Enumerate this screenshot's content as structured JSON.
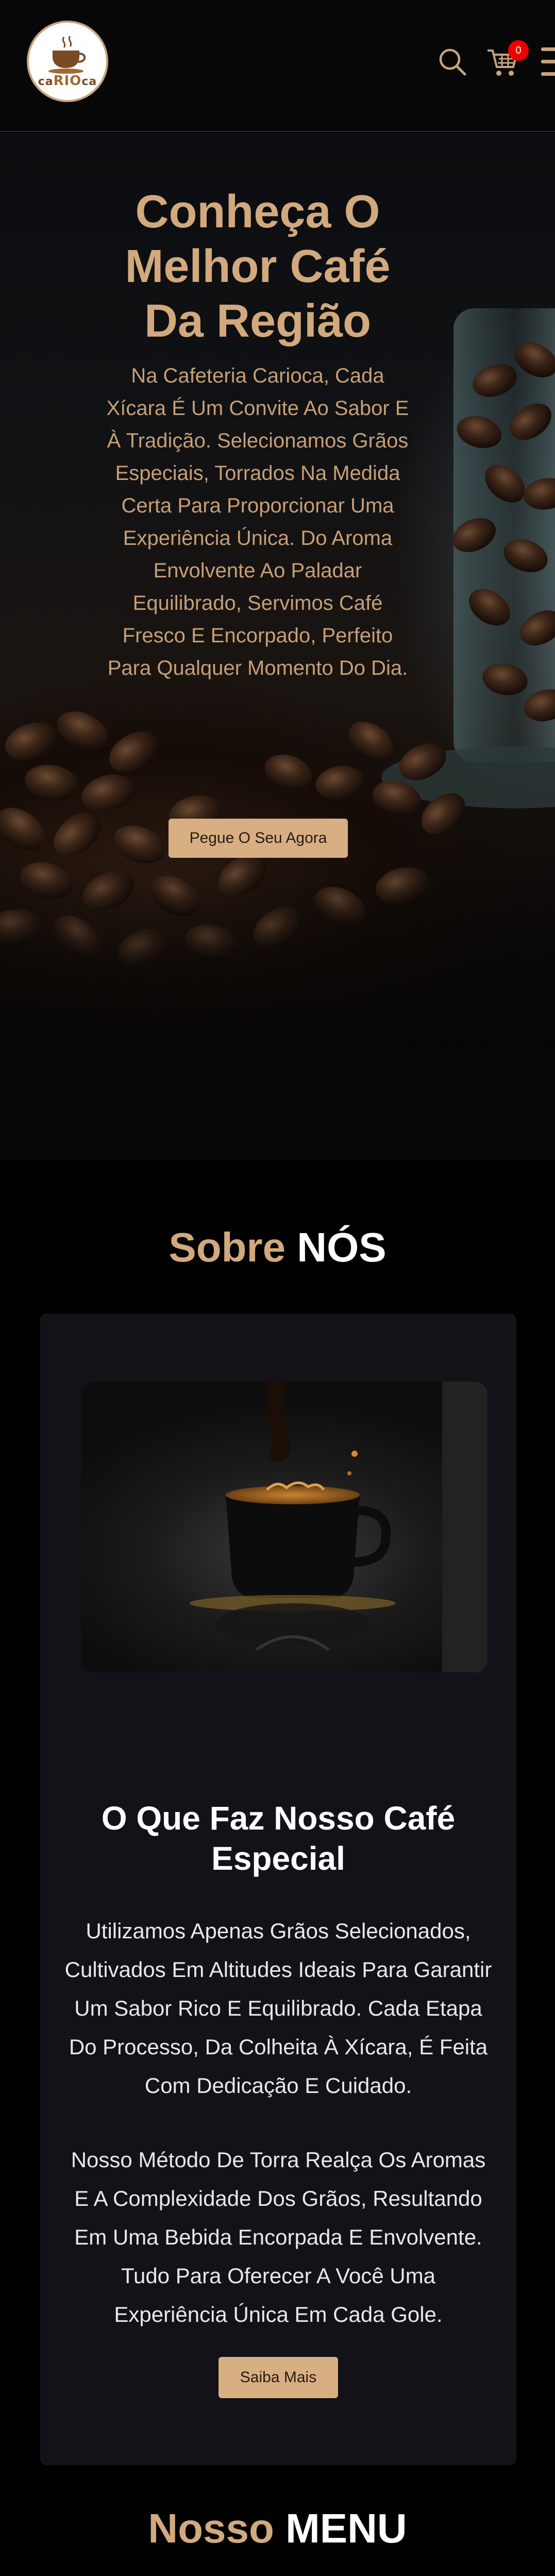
{
  "header": {
    "logo_text_pre": "ca",
    "logo_text_rio": "RIO",
    "logo_text_post": "ca",
    "cart_count": "0",
    "icons": [
      "search-icon",
      "cart-icon",
      "hamburger-menu-icon"
    ],
    "accent_color": "#c8a47e",
    "badge_color": "#e00000"
  },
  "hero": {
    "title": "Conheça O Melhor Café Da Região",
    "text": "Na Cafeteria Carioca, Cada Xícara É Um Convite Ao Sabor E À Tradição. Selecionamos Grãos Especiais, Torrados Na Medida Certa Para Proporcionar Uma Experiência Única. Do Aroma Envolvente Ao Paladar Equilibrado, Servimos Café Fresco E Encorpado, Perfeito Para Qualquer Momento Do Dia.",
    "button_label": "Pegue O Seu Agora",
    "title_color": "#d2a97c",
    "button_color": "#d7af83"
  },
  "about": {
    "title_accent": "Sobre",
    "title_main": "NÓS",
    "card_title": "O Que Faz Nosso Café Especial",
    "paragraph_1": "Utilizamos Apenas Grãos Selecionados, Cultivados Em Altitudes Ideais Para Garantir Um Sabor Rico E Equilibrado. Cada Etapa Do Processo, Da Colheita À Xícara, É Feita Com Dedicação E Cuidado.",
    "paragraph_2": "Nosso Método De Torra Realça Os Aromas E A Complexidade Dos Grãos, Resultando Em Uma Bebida Encorpada E Envolvente. Tudo Para Oferecer A Você Uma Experiência Única Em Cada Gole.",
    "button_label": "Saiba Mais",
    "card_color": "#121218"
  },
  "menu_section": {
    "title_accent": "Nosso",
    "title_main": "MENU"
  }
}
